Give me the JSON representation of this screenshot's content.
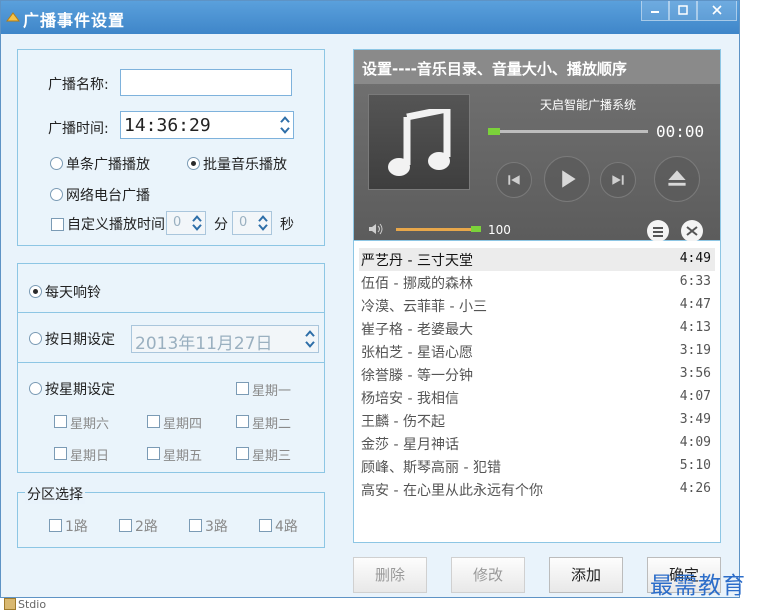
{
  "window": {
    "title": "广播事件设置"
  },
  "form": {
    "name_label": "广播名称:",
    "name_value": "",
    "time_label": "广播时间:",
    "time_value": "14:36:29",
    "mode_single": "单条广播播放",
    "mode_batch": "批量音乐播放",
    "mode_radio": "网络电台广播",
    "custom_time_label": "自定义播放时间",
    "minutes_value": "0",
    "minutes_unit": "分",
    "seconds_value": "0",
    "seconds_unit": "秒"
  },
  "schedule": {
    "daily": "每天响铃",
    "by_date": "按日期设定",
    "date_value": "2013年11月27日",
    "by_week": "按星期设定",
    "days": {
      "mon": "星期一",
      "tue": "星期二",
      "wed": "星期三",
      "thu": "星期四",
      "fri": "星期五",
      "sat": "星期六",
      "sun": "星期日"
    }
  },
  "zones": {
    "title": "分区选择",
    "items": [
      "1路",
      "2路",
      "3路",
      "4路"
    ]
  },
  "player": {
    "header": "设置----音乐目录、音量大小、播放顺序",
    "system_name": "天启智能广播系统",
    "time": "00:00",
    "volume": "100",
    "progress_fraction": 0.0,
    "volume_fraction": 1.0
  },
  "playlist": [
    {
      "name": "严艺丹 - 三寸天堂",
      "duration": "4:49",
      "selected": true
    },
    {
      "name": "伍佰 - 挪威的森林",
      "duration": "6:33"
    },
    {
      "name": "冷漠、云菲菲 - 小三",
      "duration": "4:47"
    },
    {
      "name": "崔子格 - 老婆最大",
      "duration": "4:13"
    },
    {
      "name": "张柏芝 - 星语心愿",
      "duration": "3:19"
    },
    {
      "name": "徐誉滕 - 等一分钟",
      "duration": "3:56"
    },
    {
      "name": "杨培安 - 我相信",
      "duration": "4:07"
    },
    {
      "name": "王麟 - 伤不起",
      "duration": "3:49"
    },
    {
      "name": "金莎 - 星月神话",
      "duration": "4:09"
    },
    {
      "name": "顾峰、斯琴高丽 - 犯错",
      "duration": "5:10"
    },
    {
      "name": "高安 - 在心里从此永远有个你",
      "duration": "4:26"
    }
  ],
  "buttons": {
    "delete": "删除",
    "edit": "修改",
    "add": "添加",
    "ok": "确定"
  },
  "watermark": "最需教育",
  "taskbar": {
    "label": "Stdio"
  }
}
